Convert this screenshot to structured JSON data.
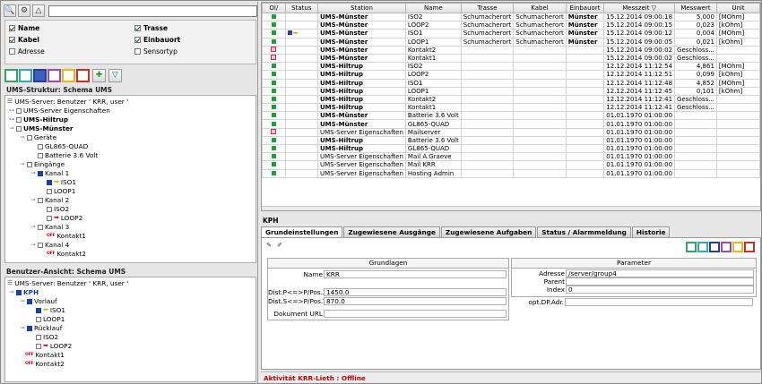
{
  "search": {
    "value": ""
  },
  "filters": [
    {
      "label": "Name",
      "checked": true
    },
    {
      "label": "Trasse",
      "checked": true
    },
    {
      "label": "Kabel",
      "checked": true
    },
    {
      "label": "Einbauort",
      "checked": true
    },
    {
      "label": "Adresse",
      "checked": false
    },
    {
      "label": "Sensortyp",
      "checked": false
    }
  ],
  "structure": {
    "title": "UMS-Struktur: Schema UMS",
    "server": "UMS-Server: Benutzer ' KRR, user '",
    "n_props": "UMS-Server Eigenschaften",
    "n_hiltrup": "UMS-Hiltrup",
    "n_muenster": "UMS-Münster",
    "n_geraete": "Geräte",
    "n_gl865": "GL865-QUAD",
    "n_batterie": "Batterie 3.6 Volt",
    "n_eingaenge": "Eingänge",
    "n_kanal1": "Kanal 1",
    "n_iso1": "ISO1",
    "n_loop1": "LOOP1",
    "n_kanal2": "Kanal 2",
    "n_iso2": "ISO2",
    "n_loop2": "LOOP2",
    "n_kanal3": "Kanal 3",
    "n_kontakt1": "Kontakt1",
    "n_kanal4": "Kanal 4",
    "n_kontakt2": "Kontakt2"
  },
  "user_view": {
    "title": "Benutzer-Ansicht: Schema UMS",
    "server": "UMS-Server: Benutzer ' KRR, user '",
    "n_kph": "KPH",
    "n_vorlauf": "Vorlauf",
    "n_iso1": "ISO1",
    "n_loop1": "LOOP1",
    "n_ruecklauf": "Rücklauf",
    "n_iso2": "ISO2",
    "n_loop2": "LOOP2",
    "n_kontakt1": "Kontakt1",
    "n_kontakt2": "Kontakt2"
  },
  "off_label": "OFF",
  "table": {
    "headers": {
      "ok": "Ol/",
      "status": "Status",
      "station": "Station",
      "name": "Name",
      "trasse": "Trasse",
      "kabel": "Kabel",
      "einbauort": "Einbauort",
      "messzeit": "Messzeit ▽",
      "messwert": "Messwert",
      "unit": "Unit"
    },
    "rows": [
      {
        "ok": "g",
        "status": "",
        "station": "UMS-Münster",
        "name": "ISO2",
        "trasse": "Schumacherort",
        "kabel": "Schumacherort",
        "einbauort": "Münster",
        "zeit": "15.12.2014 09:00:18",
        "wert": "5,000",
        "unit": "[MOhm]"
      },
      {
        "ok": "g",
        "status": "",
        "station": "UMS-Münster",
        "name": "LOOP2",
        "trasse": "Schumacherort",
        "kabel": "Schumacherort",
        "einbauort": "Münster",
        "zeit": "15.12.2014 09:00:15",
        "wert": "0,023",
        "unit": "[kOhm]"
      },
      {
        "ok": "g",
        "status": "warn",
        "station": "UMS-Münster",
        "name": "ISO1",
        "trasse": "Schumacherort",
        "kabel": "Schumacherort",
        "einbauort": "Münster",
        "zeit": "15.12.2014 09:00:12",
        "wert": "0,004",
        "unit": "[MOhm]"
      },
      {
        "ok": "g",
        "status": "",
        "station": "UMS-Münster",
        "name": "LOOP1",
        "trasse": "Schumacherort",
        "kabel": "Schumacherort",
        "einbauort": "Münster",
        "zeit": "15.12.2014 09:00:05",
        "wert": "0,021",
        "unit": "[kOhm]"
      },
      {
        "ok": "r",
        "status": "",
        "station": "UMS-Münster",
        "name": "Kontakt2",
        "trasse": "",
        "kabel": "",
        "einbauort": "",
        "zeit": "15.12.2014 09:00:02",
        "wert": "Geschloss...",
        "unit": ""
      },
      {
        "ok": "r",
        "status": "",
        "station": "UMS-Münster",
        "name": "Kontakt1",
        "trasse": "",
        "kabel": "",
        "einbauort": "",
        "zeit": "15.12.2014 09:00:02",
        "wert": "Geschloss...",
        "unit": ""
      },
      {
        "ok": "g",
        "status": "",
        "station": "UMS-Hiltrup",
        "name": "ISO2",
        "trasse": "",
        "kabel": "",
        "einbauort": "",
        "zeit": "12.12.2014 11:12:54",
        "wert": "4,861",
        "unit": "[MOhm]"
      },
      {
        "ok": "g",
        "status": "",
        "station": "UMS-Hiltrup",
        "name": "LOOP2",
        "trasse": "",
        "kabel": "",
        "einbauort": "",
        "zeit": "12.12.2014 11:12:51",
        "wert": "0,099",
        "unit": "[kOhm]"
      },
      {
        "ok": "g",
        "status": "",
        "station": "UMS-Hiltrup",
        "name": "ISO1",
        "trasse": "",
        "kabel": "",
        "einbauort": "",
        "zeit": "12.12.2014 11:12:48",
        "wert": "4,852",
        "unit": "[MOhm]"
      },
      {
        "ok": "g",
        "status": "",
        "station": "UMS-Hiltrup",
        "name": "LOOP1",
        "trasse": "",
        "kabel": "",
        "einbauort": "",
        "zeit": "12.12.2014 11:12:45",
        "wert": "0,101",
        "unit": "[kOhm]"
      },
      {
        "ok": "g",
        "status": "",
        "station": "UMS-Hiltrup",
        "name": "Kontakt2",
        "trasse": "",
        "kabel": "",
        "einbauort": "",
        "zeit": "12.12.2014 11:12:41",
        "wert": "Geschloss...",
        "unit": ""
      },
      {
        "ok": "g",
        "status": "",
        "station": "UMS-Hiltrup",
        "name": "Kontakt1",
        "trasse": "",
        "kabel": "",
        "einbauort": "",
        "zeit": "12.12.2014 11:12:41",
        "wert": "Geschloss...",
        "unit": ""
      },
      {
        "ok": "g",
        "status": "",
        "station": "UMS-Münster",
        "name": "Batterie 3.6 Volt",
        "trasse": "",
        "kabel": "",
        "einbauort": "",
        "zeit": "01.01.1970 01:00:00",
        "wert": "",
        "unit": ""
      },
      {
        "ok": "g",
        "status": "",
        "station": "UMS-Münster",
        "name": "GL865-QUAD",
        "trasse": "",
        "kabel": "",
        "einbauort": "",
        "zeit": "01.01.1970 01:00:00",
        "wert": "",
        "unit": ""
      },
      {
        "ok": "r",
        "status": "",
        "station": "UMS-Server Eigenschaften",
        "name": "Mailserver",
        "trasse": "",
        "kabel": "",
        "einbauort": "",
        "zeit": "01.01.1970 01:00:00",
        "wert": "",
        "unit": ""
      },
      {
        "ok": "g",
        "status": "",
        "station": "UMS-Hiltrup",
        "name": "Batterie 3.6 Volt",
        "trasse": "",
        "kabel": "",
        "einbauort": "",
        "zeit": "01.01.1970 01:00:00",
        "wert": "",
        "unit": ""
      },
      {
        "ok": "g",
        "status": "",
        "station": "UMS-Hiltrup",
        "name": "GL865-QUAD",
        "trasse": "",
        "kabel": "",
        "einbauort": "",
        "zeit": "01.01.1970 01:00:00",
        "wert": "",
        "unit": ""
      },
      {
        "ok": "g",
        "status": "",
        "station": "UMS-Server Eigenschaften",
        "name": "Mail A.Graeve",
        "trasse": "",
        "kabel": "",
        "einbauort": "",
        "zeit": "01.01.1970 01:00:00",
        "wert": "",
        "unit": ""
      },
      {
        "ok": "g",
        "status": "",
        "station": "UMS-Server Eigenschaften",
        "name": "Mail KRR",
        "trasse": "",
        "kabel": "",
        "einbauort": "",
        "zeit": "01.01.1970 01:00:00",
        "wert": "",
        "unit": ""
      },
      {
        "ok": "g",
        "status": "",
        "station": "UMS-Server Eigenschaften",
        "name": "Hosting Admin",
        "trasse": "",
        "kabel": "",
        "einbauort": "",
        "zeit": "01.01.1970 01:00:00",
        "wert": "",
        "unit": ""
      }
    ]
  },
  "detail": {
    "title": "KPH",
    "tabs": [
      "Grundeinstellungen",
      "Zugewiesene Ausgänge",
      "Zugewiesene Aufgaben",
      "Status / Alarmmeldung",
      "Historie"
    ],
    "grundlagen": {
      "header": "Grundlagen",
      "name_label": "Name",
      "name_value": "KRR",
      "posx_label": "Dist.P<=>P/Pos.X",
      "posx_value": "1450.0",
      "posy_label": "Dist.S<=>P/Pos.Y",
      "posy_value": "870.0",
      "url_label": "Dokument URL",
      "url_value": ""
    },
    "parameter": {
      "header": "Parameter",
      "adresse_label": "Adresse",
      "adresse_value": "/server/group4",
      "parent_label": "Parent",
      "parent_value": "",
      "index_label": "Index",
      "index_value": "0",
      "dp_label": "opt.DP.Adr.",
      "dp_value": ""
    }
  },
  "status_bar": "Aktivität KRR-Lieth : Offline",
  "colors": {
    "green": "#1f9e3c",
    "red_status": "#c00000",
    "blue": "#1a3fa8"
  }
}
